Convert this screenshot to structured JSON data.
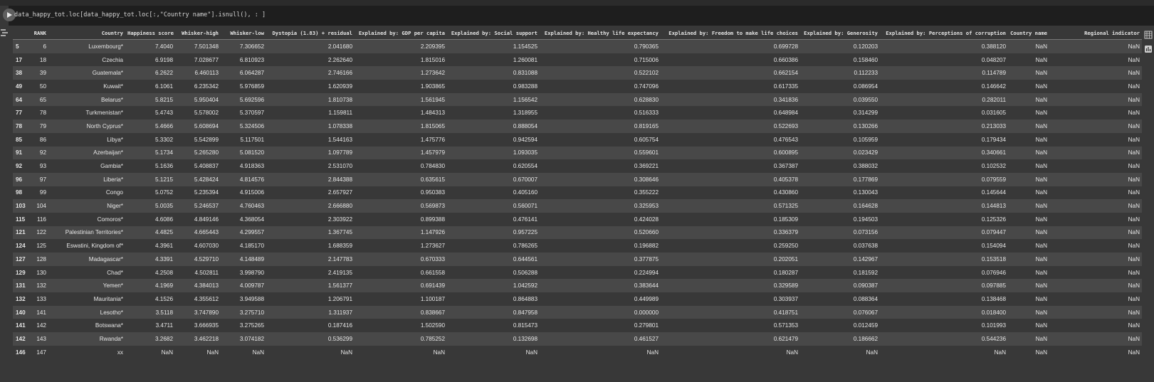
{
  "code": "data_happy_tot.loc[data_happy_tot.loc[:,\"Country name\"].isnull(), : ]",
  "columns": [
    "",
    "RANK",
    "Country",
    "Happiness score",
    "Whisker-high",
    "Whisker-low",
    "Dystopia (1.83) + residual",
    "Explained by: GDP per capita",
    "Explained by: Social support",
    "Explained by: Healthy life expectancy",
    "Explained by: Freedom to make life choices",
    "Explained by: Generosity",
    "Explained by: Perceptions of corruption",
    "Country name",
    "Regional indicator"
  ],
  "rows": [
    [
      "5",
      "6",
      "Luxembourg*",
      "7.4040",
      "7.501348",
      "7.306652",
      "2.041680",
      "2.209395",
      "1.154525",
      "0.790365",
      "0.699728",
      "0.120203",
      "0.388120",
      "NaN",
      "NaN"
    ],
    [
      "17",
      "18",
      "Czechia",
      "6.9198",
      "7.028677",
      "6.810923",
      "2.262640",
      "1.815016",
      "1.260081",
      "0.715006",
      "0.660386",
      "0.158460",
      "0.048207",
      "NaN",
      "NaN"
    ],
    [
      "38",
      "39",
      "Guatemala*",
      "6.2622",
      "6.460113",
      "6.064287",
      "2.746166",
      "1.273642",
      "0.831088",
      "0.522102",
      "0.662154",
      "0.112233",
      "0.114789",
      "NaN",
      "NaN"
    ],
    [
      "49",
      "50",
      "Kuwait*",
      "6.1061",
      "6.235342",
      "5.976859",
      "1.620939",
      "1.903865",
      "0.983288",
      "0.747096",
      "0.617335",
      "0.086954",
      "0.146642",
      "NaN",
      "NaN"
    ],
    [
      "64",
      "65",
      "Belarus*",
      "5.8215",
      "5.950404",
      "5.692596",
      "1.810738",
      "1.561945",
      "1.156542",
      "0.628830",
      "0.341836",
      "0.039550",
      "0.282011",
      "NaN",
      "NaN"
    ],
    [
      "77",
      "78",
      "Turkmenistan*",
      "5.4743",
      "5.578002",
      "5.370597",
      "1.159811",
      "1.484313",
      "1.318955",
      "0.516333",
      "0.648984",
      "0.314299",
      "0.031605",
      "NaN",
      "NaN"
    ],
    [
      "78",
      "79",
      "North Cyprus*",
      "5.4666",
      "5.608694",
      "5.324506",
      "1.078338",
      "1.815065",
      "0.888054",
      "0.819165",
      "0.522693",
      "0.130266",
      "0.213033",
      "NaN",
      "NaN"
    ],
    [
      "85",
      "86",
      "Libya*",
      "5.3302",
      "5.542899",
      "5.117501",
      "1.544163",
      "1.475776",
      "0.942594",
      "0.605754",
      "0.476543",
      "0.105959",
      "0.179434",
      "NaN",
      "NaN"
    ],
    [
      "91",
      "92",
      "Azerbaijan*",
      "5.1734",
      "5.265280",
      "5.081520",
      "1.097789",
      "1.457979",
      "1.093035",
      "0.559601",
      "0.600895",
      "0.023429",
      "0.340661",
      "NaN",
      "NaN"
    ],
    [
      "92",
      "93",
      "Gambia*",
      "5.1636",
      "5.408837",
      "4.918363",
      "2.531070",
      "0.784830",
      "0.620554",
      "0.369221",
      "0.367387",
      "0.388032",
      "0.102532",
      "NaN",
      "NaN"
    ],
    [
      "96",
      "97",
      "Liberia*",
      "5.1215",
      "5.428424",
      "4.814576",
      "2.844388",
      "0.635615",
      "0.670007",
      "0.308646",
      "0.405378",
      "0.177869",
      "0.079559",
      "NaN",
      "NaN"
    ],
    [
      "98",
      "99",
      "Congo",
      "5.0752",
      "5.235394",
      "4.915006",
      "2.657927",
      "0.950383",
      "0.405160",
      "0.355222",
      "0.430860",
      "0.130043",
      "0.145644",
      "NaN",
      "NaN"
    ],
    [
      "103",
      "104",
      "Niger*",
      "5.0035",
      "5.246537",
      "4.760463",
      "2.666880",
      "0.569873",
      "0.560071",
      "0.325953",
      "0.571325",
      "0.164628",
      "0.144813",
      "NaN",
      "NaN"
    ],
    [
      "115",
      "116",
      "Comoros*",
      "4.6086",
      "4.849146",
      "4.368054",
      "2.303922",
      "0.899388",
      "0.476141",
      "0.424028",
      "0.185309",
      "0.194503",
      "0.125326",
      "NaN",
      "NaN"
    ],
    [
      "121",
      "122",
      "Palestinian Territories*",
      "4.4825",
      "4.665443",
      "4.299557",
      "1.367745",
      "1.147926",
      "0.957225",
      "0.520660",
      "0.336379",
      "0.073156",
      "0.079447",
      "NaN",
      "NaN"
    ],
    [
      "124",
      "125",
      "Eswatini, Kingdom of*",
      "4.3961",
      "4.607030",
      "4.185170",
      "1.688359",
      "1.273627",
      "0.786265",
      "0.196882",
      "0.259250",
      "0.037638",
      "0.154094",
      "NaN",
      "NaN"
    ],
    [
      "127",
      "128",
      "Madagascar*",
      "4.3391",
      "4.529710",
      "4.148489",
      "2.147783",
      "0.670333",
      "0.644561",
      "0.377875",
      "0.202051",
      "0.142967",
      "0.153518",
      "NaN",
      "NaN"
    ],
    [
      "129",
      "130",
      "Chad*",
      "4.2508",
      "4.502811",
      "3.998790",
      "2.419135",
      "0.661558",
      "0.506288",
      "0.224994",
      "0.180287",
      "0.181592",
      "0.076946",
      "NaN",
      "NaN"
    ],
    [
      "131",
      "132",
      "Yemen*",
      "4.1969",
      "4.384013",
      "4.009787",
      "1.561377",
      "0.691439",
      "1.042592",
      "0.383644",
      "0.329589",
      "0.090387",
      "0.097885",
      "NaN",
      "NaN"
    ],
    [
      "132",
      "133",
      "Mauritania*",
      "4.1526",
      "4.355612",
      "3.949588",
      "1.206791",
      "1.100187",
      "0.864883",
      "0.449989",
      "0.303937",
      "0.088364",
      "0.138468",
      "NaN",
      "NaN"
    ],
    [
      "140",
      "141",
      "Lesotho*",
      "3.5118",
      "3.747890",
      "3.275710",
      "1.311937",
      "0.838667",
      "0.847958",
      "0.000000",
      "0.418751",
      "0.076067",
      "0.018400",
      "NaN",
      "NaN"
    ],
    [
      "141",
      "142",
      "Botswana*",
      "3.4711",
      "3.666935",
      "3.275265",
      "0.187416",
      "1.502590",
      "0.815473",
      "0.279801",
      "0.571353",
      "0.012459",
      "0.101993",
      "NaN",
      "NaN"
    ],
    [
      "142",
      "143",
      "Rwanda*",
      "3.2682",
      "3.462218",
      "3.074182",
      "0.536299",
      "0.785252",
      "0.132698",
      "0.461527",
      "0.621479",
      "0.186662",
      "0.544236",
      "NaN",
      "NaN"
    ],
    [
      "146",
      "147",
      "xx",
      "NaN",
      "NaN",
      "NaN",
      "NaN",
      "NaN",
      "NaN",
      "NaN",
      "NaN",
      "NaN",
      "NaN",
      "NaN",
      "NaN"
    ]
  ]
}
